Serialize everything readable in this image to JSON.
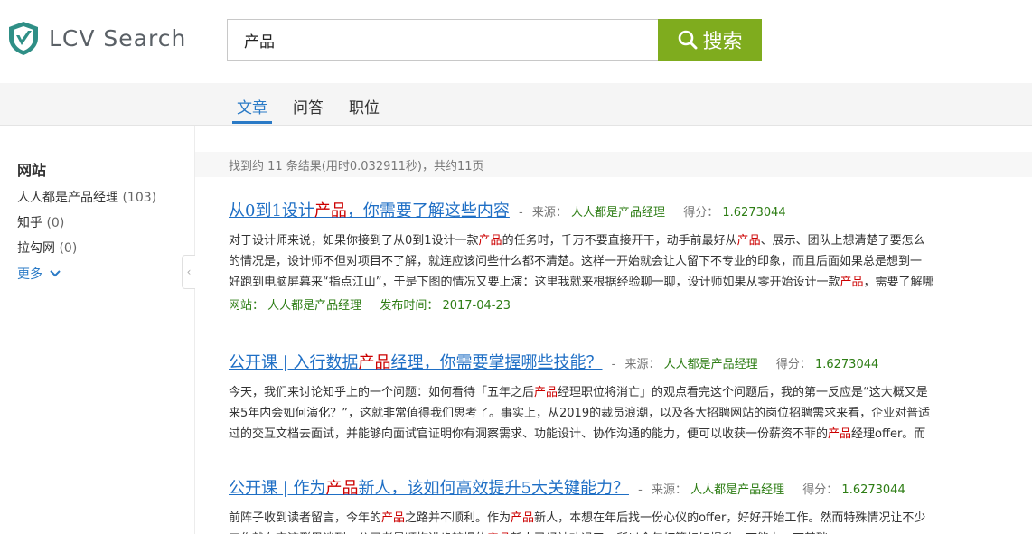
{
  "header": {
    "logo_text": "LCV Search",
    "search_value": "产品",
    "search_button_label": "搜索"
  },
  "tabs": [
    {
      "label": "文章",
      "active": true
    },
    {
      "label": "问答",
      "active": false
    },
    {
      "label": "职位",
      "active": false
    }
  ],
  "sidebar": {
    "title": "网站",
    "items": [
      {
        "label": "人人都是产品经理",
        "count": "(103)"
      },
      {
        "label": "知乎",
        "count": "(0)"
      },
      {
        "label": "拉勾网",
        "count": "(0)"
      }
    ],
    "more_label": "更多"
  },
  "stats": "找到约 11 条结果(用时0.032911秒)，共约11页",
  "meta_labels": {
    "source": "来源：",
    "score": "得分：",
    "site": "网站：",
    "published": "发布时间："
  },
  "results": [
    {
      "title_html": "从0到1设计<span class=\"hl\">产品</span>，你需要了解这些内容",
      "source": "人人都是产品经理",
      "score": "1.6273044",
      "snippet_html": "对于设计师来说，如果你接到了从0到1设计一款<span class=\"hl\">产品</span>的任务时，千万不要直接开干，动手前最好从<span class=\"hl\">产品</span>、展示、团队上想清楚了要怎么<br>的情况是，设计师不但对项目不了解，就连应该问些什么都不清楚。这样一开始就会让人留下不专业的印象，而且后面如果总是想到一<br>好跑到电脑屏幕来“指点江山”，于是下图的情况又要上演：这里我就来根据经验聊一聊，设计师如果从零开始设计一款<span class=\"hl\">产品</span>，需要了解哪",
      "site": "人人都是产品经理",
      "date": "2017-04-23"
    },
    {
      "title_html": "公开课 | 入行数据<span class=\"hl\">产品</span>经理，你需要掌握哪些技能？",
      "source": "人人都是产品经理",
      "score": "1.6273044",
      "snippet_html": "今天，我们来讨论知乎上的一个问题：如何看待「五年之后<span class=\"hl\">产品</span>经理职位将消亡」的观点看完这个问题后，我的第一反应是“这大概又是<br>来5年内会如何演化？”，这就非常值得我们思考了。事实上，从2019的裁员浪潮，以及各大招聘网站的岗位招聘需求来看，企业对普适<br>过的交互文档去面试，并能够向面试官证明你有洞察需求、功能设计、协作沟通的能力，便可以收获一份薪资不菲的<span class=\"hl\">产品</span>经理offer。而"
    },
    {
      "title_html": "公开课 | 作为<span class=\"hl\">产品</span>新人，该如何高效提升5大关键能力？",
      "source": "人人都是产品经理",
      "score": "1.6273044",
      "snippet_html": "前阵子收到读者留言，今年的<span class=\"hl\">产品</span>之路并不顺利。作为<span class=\"hl\">产品</span>新人，本想在年后找一份心仪的offer，好好开始工作。然而特殊情况让不少<br>工作就在交流群里谈到，公司老是顺拖进步较慢的<span class=\"hl\">产品</span>新人已经被劝退了，所以今年打算好好提升一下能力，可基础..."
    }
  ],
  "colors": {
    "brand_green": "#7fac1e",
    "link_blue": "#1f6fc5",
    "highlight_red": "#cc0000",
    "meta_green": "#2d7d14"
  }
}
